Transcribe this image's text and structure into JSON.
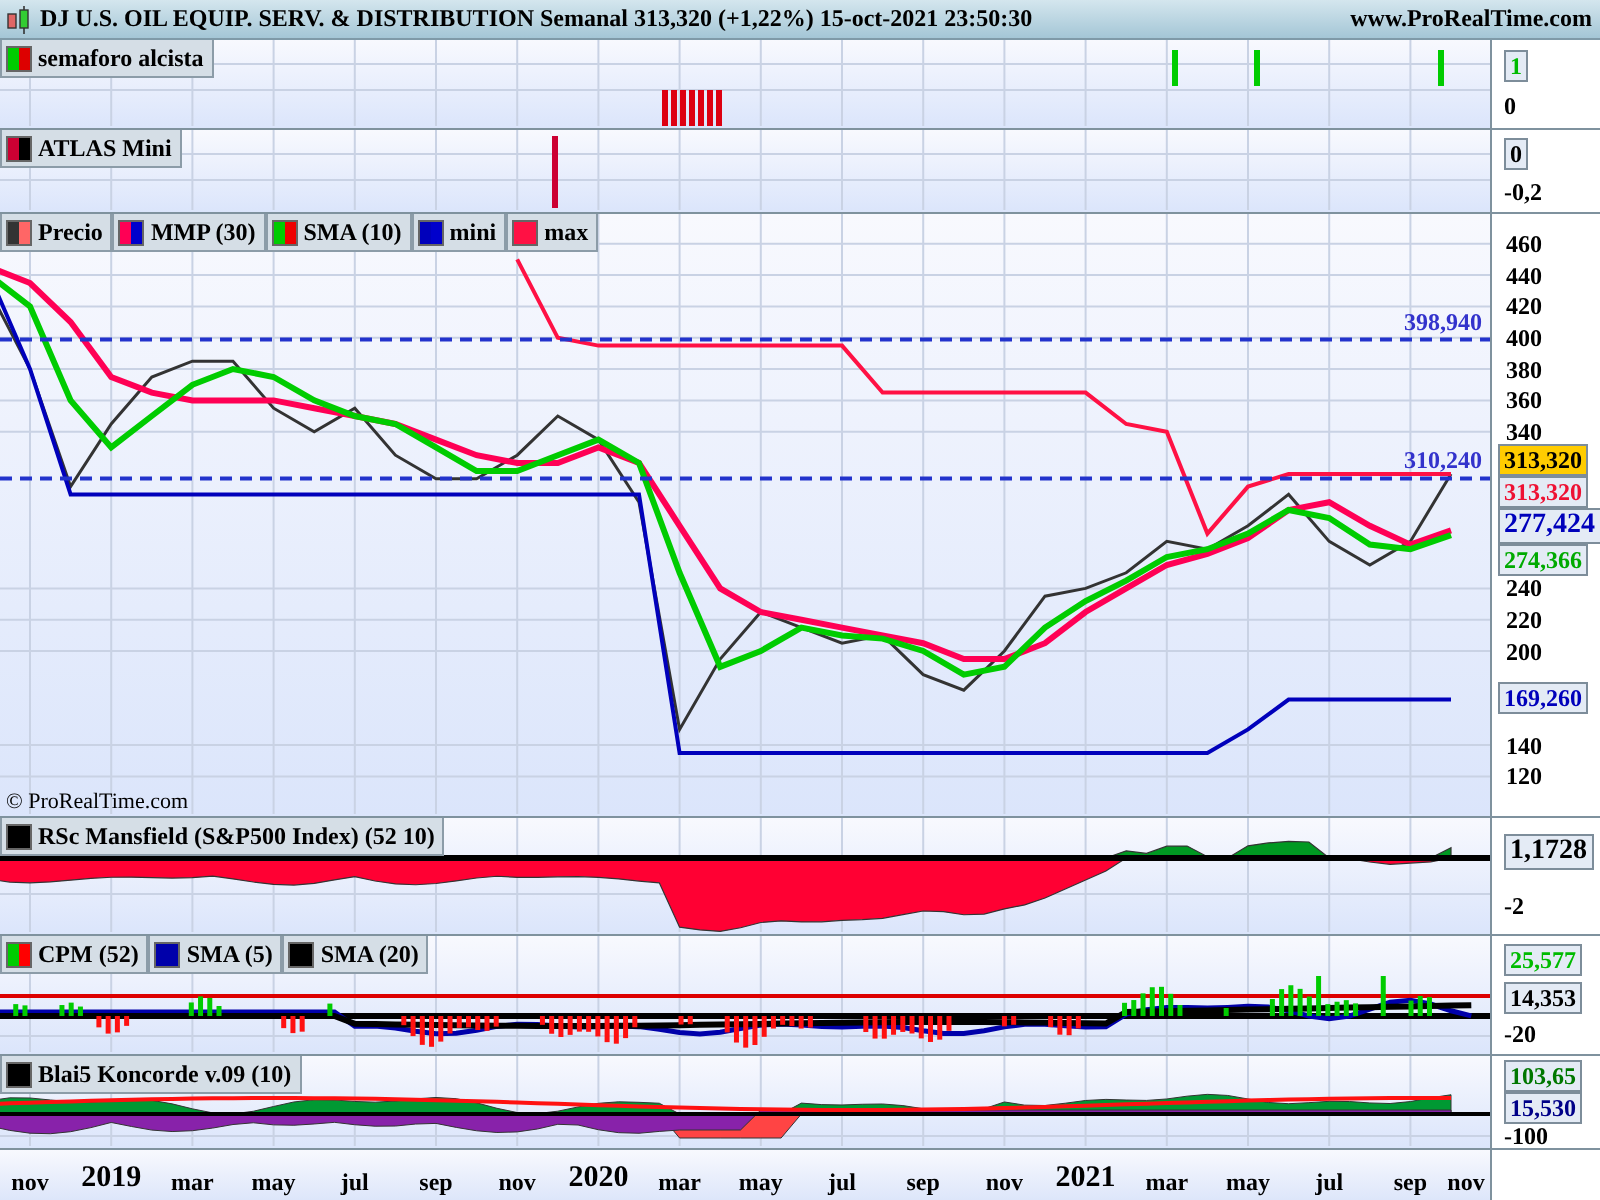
{
  "header": {
    "title": "DJ U.S. OIL EQUIP. SERV. & DISTRIBUTION Semanal 313,320 (+1,22%) 15-oct-2021 23:50:30",
    "site": "www.ProRealTime.com"
  },
  "panels": [
    {
      "kind": "semaforo",
      "legend": [
        {
          "label": "semaforo alcista",
          "color": "#00cc00"
        }
      ],
      "axis_labels": [
        {
          "text": "1",
          "kind": "badge",
          "color": "#00bb00"
        },
        {
          "text": "0",
          "kind": "tick"
        }
      ]
    },
    {
      "kind": "atlas",
      "legend": [
        {
          "label": "ATLAS Mini",
          "color": "#cc0033"
        }
      ],
      "axis_labels": [
        {
          "text": "0",
          "kind": "badge"
        },
        {
          "text": "-0,2",
          "kind": "tick"
        }
      ]
    },
    {
      "kind": "price",
      "copyright": "© ProRealTime.com",
      "legend": [
        {
          "label": "Precio",
          "color": "#333333"
        },
        {
          "label": "MMP (30)",
          "color": "#ff0055"
        },
        {
          "label": "SMA (10)",
          "color": "#00cc00"
        },
        {
          "label": "mini",
          "color": "#0000bb"
        },
        {
          "label": "max",
          "color": "#ff1144"
        }
      ],
      "y_axis": [
        "460",
        "440",
        "420",
        "400",
        "380",
        "360",
        "340",
        "240",
        "220",
        "200",
        "140",
        "120"
      ],
      "level_lines": [
        {
          "text": "398,940"
        },
        {
          "text": "310,240"
        }
      ],
      "badges": [
        {
          "text": "313,320",
          "highlighted": true
        },
        {
          "text": "313,320",
          "color": "#ee1133",
          "highlighted": false
        },
        {
          "text": "277,424",
          "color": "#0000bb",
          "highlighted": false
        },
        {
          "text": "274,366",
          "color": "#00aa00",
          "highlighted": false
        }
      ],
      "mini_badge": {
        "text": "169,260",
        "color": "#0000bb",
        "highlighted": false
      }
    },
    {
      "kind": "rsc",
      "legend": [
        {
          "label": "RSc Mansfield (S&P500 Index) (52 10)",
          "color": "#000000"
        }
      ],
      "axis_labels": [
        {
          "text": "1,1728",
          "kind": "big_badge"
        },
        {
          "text": "-2",
          "kind": "tick"
        }
      ]
    },
    {
      "kind": "cpm",
      "legend": [
        {
          "label": "CPM (52)",
          "color": "#00cc00"
        },
        {
          "label": "SMA (5)",
          "color": "#0000aa"
        },
        {
          "label": "SMA (20)",
          "color": "#000000"
        }
      ],
      "axis_labels": [
        {
          "text": "25,577",
          "kind": "badge",
          "color": "#00bb00"
        },
        {
          "text": "14,353",
          "kind": "badge"
        },
        {
          "text": "-20",
          "kind": "tick"
        }
      ]
    },
    {
      "kind": "koncorde",
      "legend": [
        {
          "label": "Blai5 Koncorde v.09 (10)",
          "color": "#000000"
        }
      ],
      "axis_labels": [
        {
          "text": "103,65",
          "kind": "badge",
          "color": "#007700"
        },
        {
          "text": "15,530",
          "kind": "badge",
          "color": "#000088"
        },
        {
          "text": "-100",
          "kind": "tick"
        }
      ]
    }
  ],
  "time_axis": [
    {
      "label": "nov",
      "kind": "month"
    },
    {
      "label": "2019",
      "kind": "year"
    },
    {
      "label": "mar",
      "kind": "month"
    },
    {
      "label": "may",
      "kind": "month"
    },
    {
      "label": "jul",
      "kind": "month"
    },
    {
      "label": "sep",
      "kind": "month"
    },
    {
      "label": "nov",
      "kind": "month"
    },
    {
      "label": "2020",
      "kind": "year"
    },
    {
      "label": "mar",
      "kind": "month"
    },
    {
      "label": "may",
      "kind": "month"
    },
    {
      "label": "jul",
      "kind": "month"
    },
    {
      "label": "sep",
      "kind": "month"
    },
    {
      "label": "nov",
      "kind": "month"
    },
    {
      "label": "2021",
      "kind": "year"
    },
    {
      "label": "mar",
      "kind": "month"
    },
    {
      "label": "may",
      "kind": "month"
    },
    {
      "label": "jul",
      "kind": "month"
    },
    {
      "label": "sep",
      "kind": "month"
    },
    {
      "label": "nov",
      "kind": "month"
    }
  ]
}
